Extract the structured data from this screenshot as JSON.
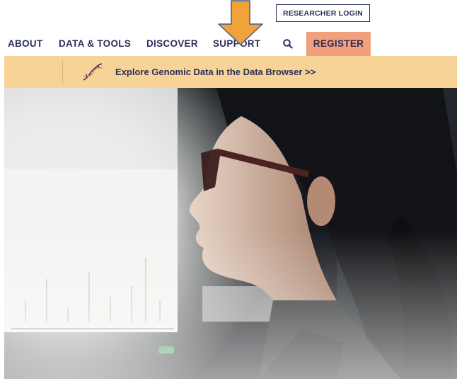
{
  "header": {
    "researcher_login": "RESEARCHER LOGIN"
  },
  "nav": {
    "items": [
      {
        "label": "ABOUT"
      },
      {
        "label": "DATA & TOOLS"
      },
      {
        "label": "DISCOVER"
      },
      {
        "label": "SUPPORT"
      }
    ],
    "search_icon": "search-icon",
    "register": "REGISTER"
  },
  "banner": {
    "icon": "dna-icon",
    "link_text": "Explore Genomic Data in the Data Browser >>"
  },
  "colors": {
    "navy": "#2b2f5a",
    "register_bg": "#f2a07b",
    "banner_bg": "#f7d397",
    "arrow": "#f0a33a"
  }
}
